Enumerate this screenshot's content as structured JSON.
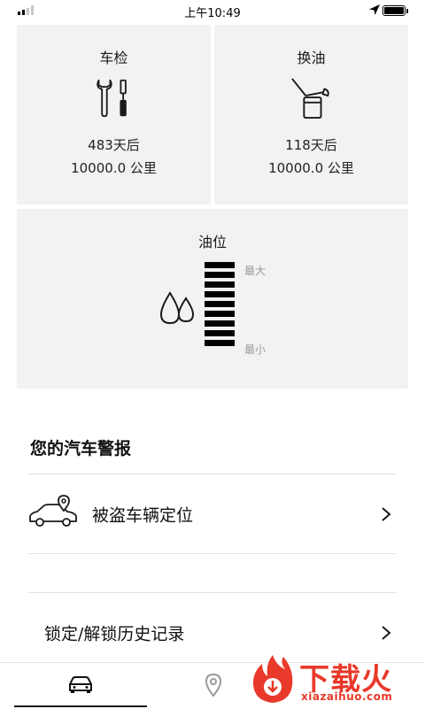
{
  "status_bar": {
    "time": "上午10:49"
  },
  "maintenance": {
    "inspection": {
      "title": "车检",
      "days": "483天后",
      "distance": "10000.0 公里"
    },
    "oil_change": {
      "title": "换油",
      "days": "118天后",
      "distance": "10000.0 公里"
    }
  },
  "fuel": {
    "title": "油位",
    "max_label": "最大",
    "min_label": "最小",
    "level_fraction": 1.0,
    "segments_filled": 9
  },
  "alerts": {
    "section_title": "您的汽车警报",
    "items": [
      {
        "label": "被盗车辆定位"
      },
      {
        "label": "锁定/解锁历史记录"
      }
    ]
  },
  "tabbar": {
    "tabs": [
      {
        "icon": "car-icon",
        "active": true
      },
      {
        "icon": "location-pin-icon",
        "active": false
      }
    ]
  },
  "watermark": {
    "brand": "下载火",
    "domain": "xiazaihuo.com"
  },
  "colors": {
    "card_bg": "#f2f2f2",
    "watermark": "#e8392a"
  }
}
